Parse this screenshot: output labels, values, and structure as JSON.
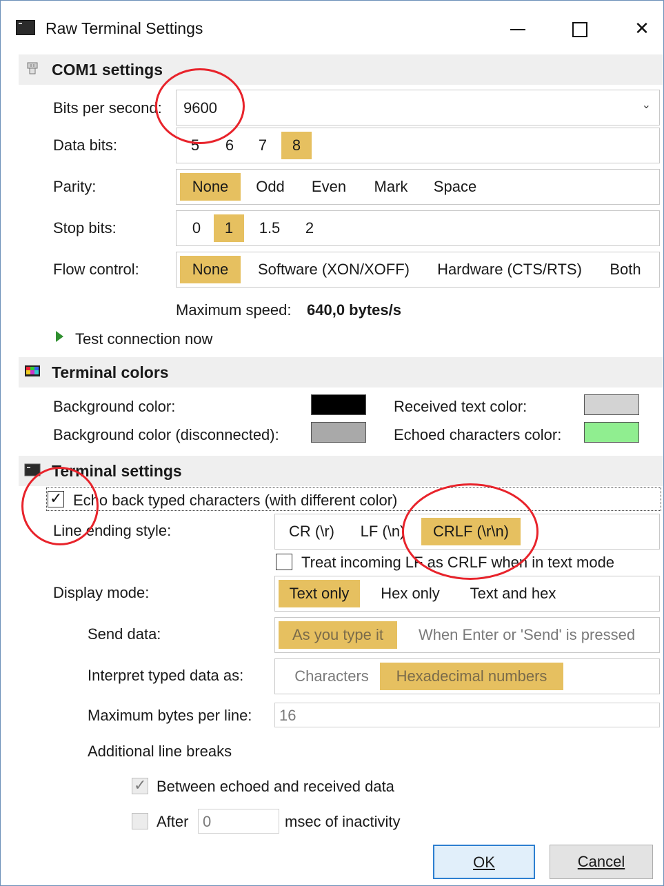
{
  "window": {
    "title": "Raw Terminal Settings"
  },
  "com": {
    "section_title": "COM1 settings",
    "bits_label": "Bits per second:",
    "bits_value": "9600",
    "data_bits_label": "Data bits:",
    "data_bits_options": [
      "5",
      "6",
      "7",
      "8"
    ],
    "data_bits_selected": "8",
    "parity_label": "Parity:",
    "parity_options": [
      "None",
      "Odd",
      "Even",
      "Mark",
      "Space"
    ],
    "parity_selected": "None",
    "stop_bits_label": "Stop bits:",
    "stop_bits_options": [
      "0",
      "1",
      "1.5",
      "2"
    ],
    "stop_bits_selected": "1",
    "flow_label": "Flow control:",
    "flow_options": [
      "None",
      "Software (XON/XOFF)",
      "Hardware (CTS/RTS)",
      "Both"
    ],
    "flow_selected": "None",
    "max_speed_label": "Maximum speed:",
    "max_speed_value": "640,0 bytes/s",
    "test_link": "Test connection now"
  },
  "colors": {
    "section_title": "Terminal colors",
    "bg_label": "Background color:",
    "bg_color": "#000000",
    "bg_disc_label": "Background color (disconnected):",
    "bg_disc_color": "#a9a9a9",
    "recv_label": "Received text color:",
    "recv_color": "#d3d3d3",
    "echo_label": "Echoed characters color:",
    "echo_color": "#90ee90"
  },
  "terminal": {
    "section_title": "Terminal settings",
    "echo_label": "Echo back typed characters (with different color)",
    "echo_checked": true,
    "line_ending_label": "Line ending style:",
    "line_ending_options": [
      "CR (\\r)",
      "LF (\\n)",
      "CRLF (\\r\\n)"
    ],
    "line_ending_selected": "CRLF (\\r\\n)",
    "treat_lf_label": "Treat incoming LF as CRLF when in text mode",
    "treat_lf_checked": false,
    "display_label": "Display mode:",
    "display_options": [
      "Text only",
      "Hex only",
      "Text and hex"
    ],
    "display_selected": "Text only",
    "send_label": "Send data:",
    "send_options": [
      "As you type it",
      "When Enter or 'Send' is pressed"
    ],
    "send_selected": "As you type it",
    "interpret_label": "Interpret typed data as:",
    "interpret_options": [
      "Characters",
      "Hexadecimal numbers"
    ],
    "interpret_selected": "Hexadecimal numbers",
    "max_bytes_label": "Maximum bytes per line:",
    "max_bytes_value": "16",
    "additional_label": "Additional line breaks",
    "between_label": "Between echoed and received data",
    "between_checked": true,
    "after_label": "After",
    "after_value": "0",
    "msec_label": "msec of inactivity"
  },
  "buttons": {
    "ok_label": "OK",
    "cancel_label": "Cancel"
  },
  "accent": {
    "selected_option": "#e6c060",
    "annotation_circle": "#e8232b"
  }
}
